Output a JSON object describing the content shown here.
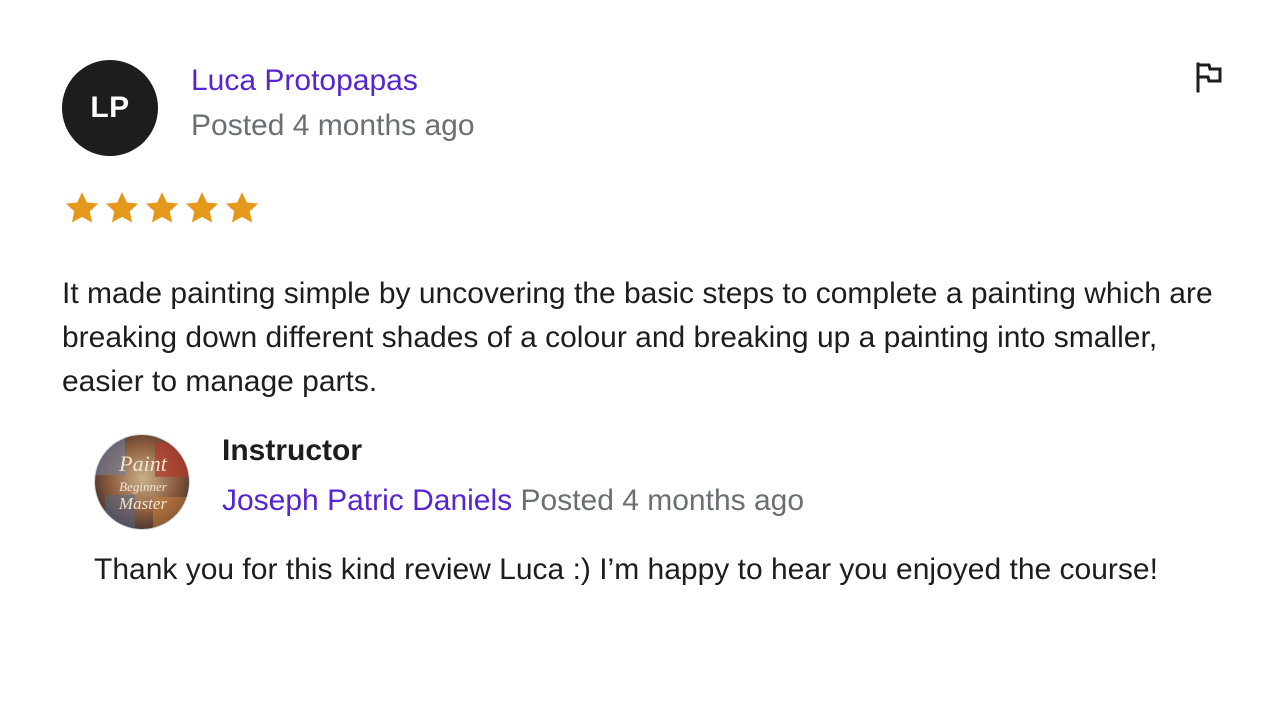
{
  "review": {
    "avatar_initials": "LP",
    "reviewer_name": "Luca Protopapas",
    "posted": "Posted 4 months ago",
    "rating": 5,
    "rating_max": 5,
    "star_color": "#e59819",
    "text": "It made painting simple by uncovering the basic steps to complete a painting which are breaking down different shades of a colour and breaking up a painting into smaller, easier to manage parts.",
    "report_icon": "flag-icon"
  },
  "response": {
    "role": "Instructor",
    "instructor_name": "Joseph Patric Daniels",
    "posted": "Posted 4 months ago",
    "avatar_logo_text": "Paint Beginner Master",
    "text": "Thank you for this kind review Luca :) I’m happy to hear you enjoyed the course!"
  },
  "colors": {
    "link": "#5624d0",
    "muted": "#6a6f73",
    "text": "#1c1d1f"
  }
}
